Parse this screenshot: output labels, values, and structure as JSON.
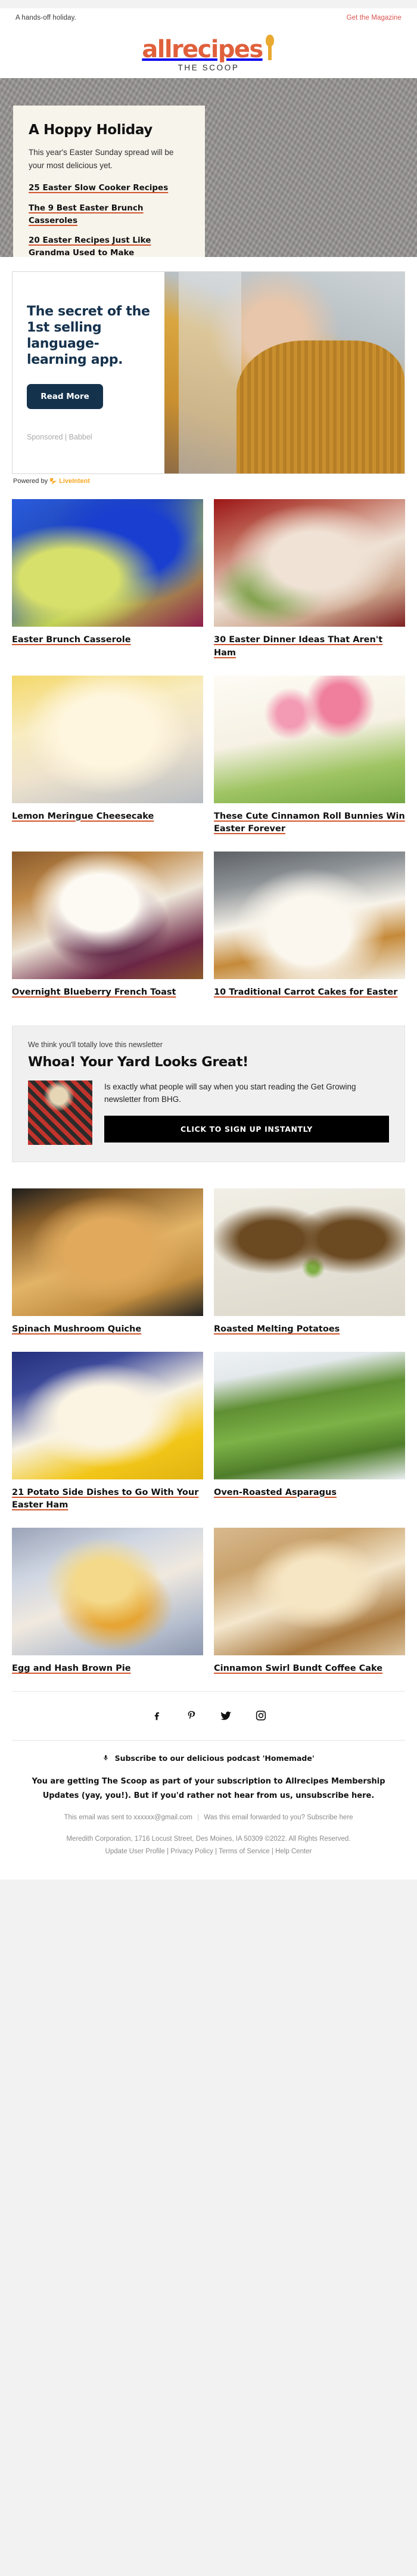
{
  "preheader": {
    "teaser": "A hands-off holiday.",
    "magazine_link": "Get the Magazine"
  },
  "masthead": {
    "logo_text": "allrecipes",
    "tagline": "THE SCOOP"
  },
  "hero": {
    "title": "A Hoppy Holiday",
    "subtitle": "This year's Easter Sunday spread will be your most delicious yet.",
    "links": [
      "25 Easter Slow Cooker Recipes",
      "The 9 Best Easter Brunch Casseroles",
      "20 Easter Recipes Just Like Grandma Used to Make"
    ]
  },
  "ad": {
    "headline": "The secret of the 1st selling language-learning app.",
    "cta_label": "Read More",
    "sponsor": "Sponsored | Babbel",
    "powered_by_prefix": "Powered by",
    "powered_by_name": "LiveIntent"
  },
  "recipes_top": [
    {
      "title": "Easter Brunch Casserole",
      "photo": "ph-casserole"
    },
    {
      "title": "30 Easter Dinner Ideas That Aren't Ham",
      "photo": "ph-ham"
    },
    {
      "title": "Lemon Meringue Cheesecake",
      "photo": "ph-lemon"
    },
    {
      "title": "These Cute Cinnamon Roll Bunnies Win Easter Forever",
      "photo": "ph-bunny"
    },
    {
      "title": "Overnight Blueberry French Toast",
      "photo": "ph-french"
    },
    {
      "title": "10 Traditional Carrot Cakes for Easter",
      "photo": "ph-carrot"
    }
  ],
  "promo": {
    "kicker": "We think you'll totally love this newsletter",
    "title": "Whoa! Your Yard Looks Great!",
    "copy": "Is exactly what people will say when you start reading the Get Growing newsletter from BHG.",
    "button_label": "CLICK TO SIGN UP INSTANTLY"
  },
  "recipes_bottom": [
    {
      "title": "Spinach Mushroom Quiche",
      "photo": "ph-quiche"
    },
    {
      "title": "Roasted Melting Potatoes",
      "photo": "ph-potatoes"
    },
    {
      "title": "21 Potato Side Dishes to Go With Your Easter Ham",
      "photo": "ph-potatoside"
    },
    {
      "title": "Oven-Roasted Asparagus",
      "photo": "ph-asparagus"
    },
    {
      "title": "Egg and Hash Brown Pie",
      "photo": "ph-eggpie"
    },
    {
      "title": "Cinnamon Swirl Bundt Coffee Cake",
      "photo": "ph-bundt"
    }
  ],
  "footer": {
    "social": [
      {
        "name": "facebook",
        "label": "Facebook"
      },
      {
        "name": "pinterest",
        "label": "Pinterest"
      },
      {
        "name": "twitter",
        "label": "Twitter"
      },
      {
        "name": "instagram",
        "label": "Instagram"
      }
    ],
    "podcast": "Subscribe to our delicious podcast 'Homemade'",
    "subscription_note": "You are getting The Scoop as part of your subscription to Allrecipes Membership Updates (yay, you!). But if you'd rather not hear from us, unsubscribe here.",
    "sent_to": "This email was sent to xxxxxx@gmail.com",
    "forwarded": "Was this email forwarded to you? Subscribe here",
    "copyright": "Meredith Corporation, 1716 Locust Street, Des Moines, IA 50309 ©2022. All Rights Reserved.",
    "links": [
      "Update User Profile",
      "Privacy Policy",
      "Terms of Service",
      "Help Center"
    ]
  },
  "colors": {
    "brand": "#e0603c",
    "spoon": "#eaa92f",
    "link_underline": "#d2572e",
    "ad_navy": "#15324d",
    "liveintent": "#f7a823"
  }
}
